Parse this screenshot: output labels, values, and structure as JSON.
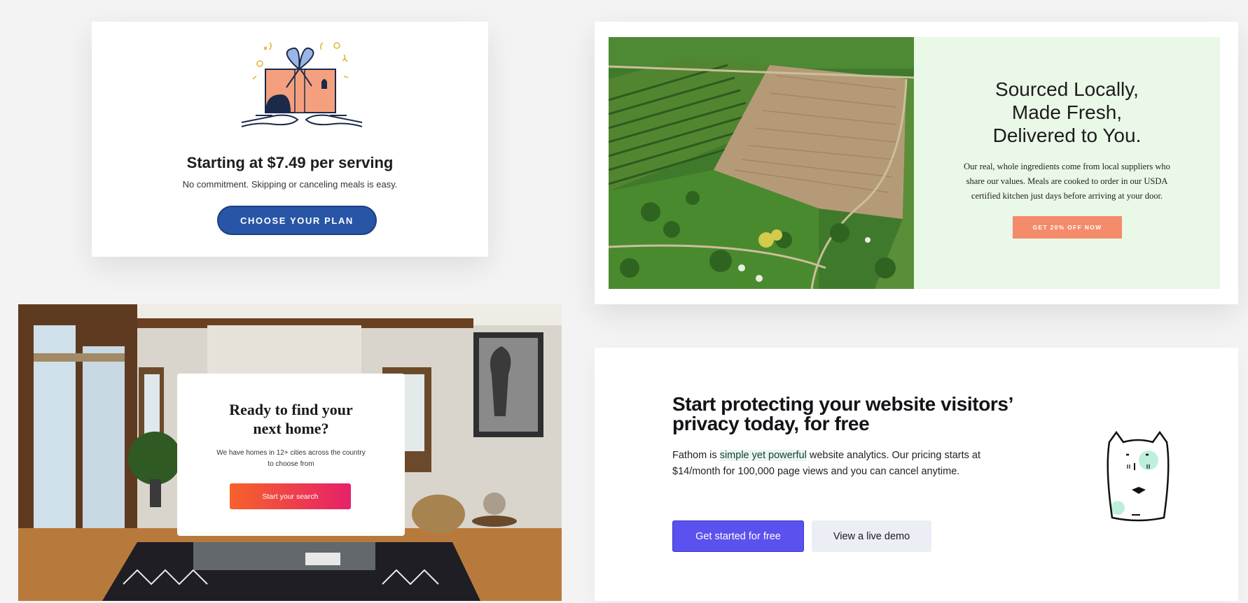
{
  "meal_card": {
    "title": "Starting at $7.49 per serving",
    "subtitle": "No commitment. Skipping or canceling meals is easy.",
    "button": "CHOOSE YOUR PLAN",
    "colors": {
      "button": "#2855a6",
      "gift": "#f4a07f"
    }
  },
  "local_card": {
    "heading_lines": [
      "Sourced Locally,",
      "Made Fresh,",
      "Delivered to You."
    ],
    "body": "Our real, whole ingredients come from local suppliers who share our values. Meals are cooked to order in our USDA certified kitchen just days before arriving at your door.",
    "button": "GET 20% OFF NOW",
    "colors": {
      "panel": "#eaf8e7",
      "button": "#f48b6b"
    }
  },
  "home_card": {
    "title_lines": [
      "Ready to find your",
      "next home?"
    ],
    "body": "We have homes in 12+ cities across the country to choose from",
    "button": "Start your search"
  },
  "fathom_card": {
    "heading": "Start protecting your website visitors’ privacy today, for free",
    "para_before": "Fathom is",
    "para_highlight": "simple yet powerful",
    "para_after": "website analytics. Our pricing starts at $14/month for 100,000 page views and you can cancel anytime.",
    "primary_button": "Get started for free",
    "secondary_button": "View a live demo",
    "colors": {
      "primary": "#5b51ee",
      "secondary": "#eceef6"
    },
    "mascot_icon": "cat-mascot-icon"
  }
}
